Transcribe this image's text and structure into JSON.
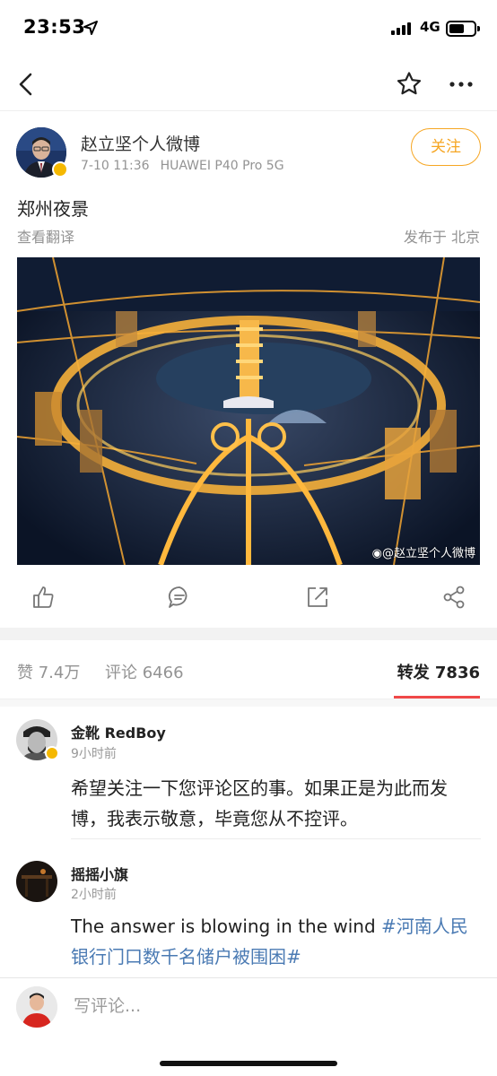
{
  "status_bar": {
    "time": "23:53",
    "network": "4G"
  },
  "post": {
    "author": "赵立坚个人微博",
    "date": "7-10 11:36",
    "device": "HUAWEI P40 Pro 5G",
    "follow_label": "关注",
    "text": "郑州夜景",
    "translate_label": "查看翻译",
    "posted_from": "发布于 北京",
    "watermark": "@赵立坚个人微博"
  },
  "tabs": {
    "likes": "赞 7.4万",
    "comments": "评论 6466",
    "reposts": "转发 7836"
  },
  "reposts": [
    {
      "name": "金靴 RedBoy",
      "time": "9小时前",
      "text": "希望关注一下您评论区的事。如果正是为此而发博，我表示敬意，毕竟您从不控评。",
      "topic": ""
    },
    {
      "name": "摇摇小旗",
      "time": "2小时前",
      "text": "The answer is blowing in the wind ",
      "topic": "#河南人民银行门口数千名储户被围困#"
    }
  ],
  "comment_bar": {
    "placeholder": "写评论..."
  },
  "colors": {
    "accent_orange": "#f6a623",
    "tab_underline": "#f04848",
    "topic_link": "#4a7ab3",
    "verified_badge": "#f5b800"
  },
  "icons": [
    "back-icon",
    "star-icon",
    "more-icon",
    "like-icon",
    "comment-icon",
    "repost-icon",
    "share-icon",
    "weibo-logo-icon",
    "location-arrow-icon",
    "signal-icon",
    "battery-icon"
  ]
}
